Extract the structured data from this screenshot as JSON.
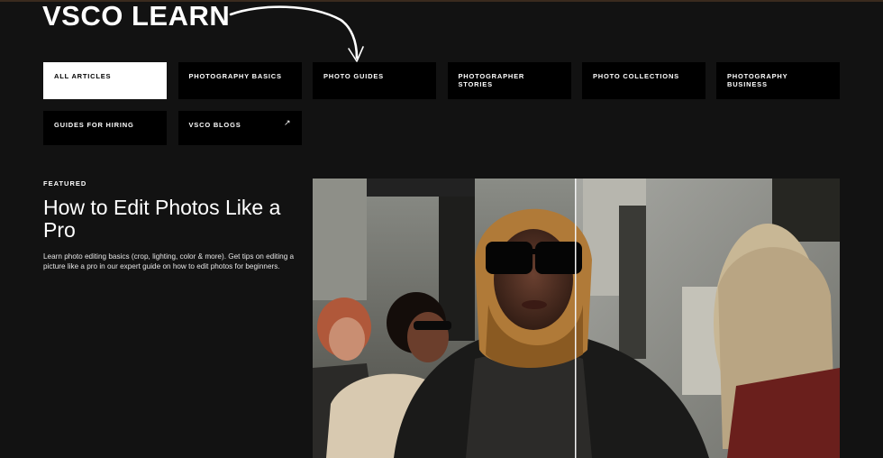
{
  "brand": {
    "title": "VSCO LEARN"
  },
  "nav": {
    "items": [
      {
        "label": "ALL ARTICLES",
        "active": true
      },
      {
        "label": "PHOTOGRAPHY BASICS",
        "active": false
      },
      {
        "label": "PHOTO GUIDES",
        "active": false
      },
      {
        "label": "PHOTOGRAPHER STORIES",
        "active": false
      },
      {
        "label": "PHOTO COLLECTIONS",
        "active": false
      },
      {
        "label": "PHOTOGRAPHY BUSINESS",
        "active": false
      },
      {
        "label": "GUIDES FOR HIRING",
        "active": false
      },
      {
        "label": "VSCO BLOGS",
        "active": false,
        "external_icon": "↗"
      }
    ]
  },
  "featured": {
    "label": "FEATURED",
    "headline": "How to Edit Photos Like a Pro",
    "summary": "Learn photo editing basics (crop, lighting, color & more). Get tips on editing a picture like a pro in our expert guide on how to edit photos for beginners.",
    "image_icon": "photo-before-after-comparison"
  },
  "colors": {
    "background": "#121212",
    "nav_button": "#000000",
    "nav_active": "#ffffff",
    "text": "#ffffff"
  }
}
